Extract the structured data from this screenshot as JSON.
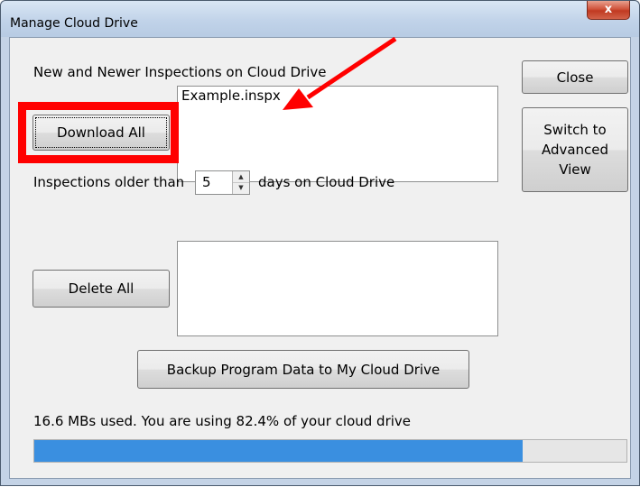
{
  "window": {
    "title": "Manage Cloud Drive",
    "close_glyph": "x"
  },
  "sections": {
    "new_label": "New and Newer Inspections on Cloud Drive",
    "new_items": [
      "Example.inspx"
    ],
    "older_prefix": "Inspections older than",
    "older_days": "5",
    "older_suffix": "days on Cloud Drive",
    "older_items": []
  },
  "buttons": {
    "download_all": "Download All",
    "delete_all": "Delete All",
    "close": "Close",
    "switch_line1": "Switch to",
    "switch_line2": "Advanced",
    "switch_line3": "View",
    "backup": "Backup Program Data to My Cloud Drive"
  },
  "usage": {
    "text": "16.6 MBs used. You are using 82.4% of your cloud drive",
    "percent": 82.4
  },
  "annotation": {
    "color": "#ff0000"
  }
}
